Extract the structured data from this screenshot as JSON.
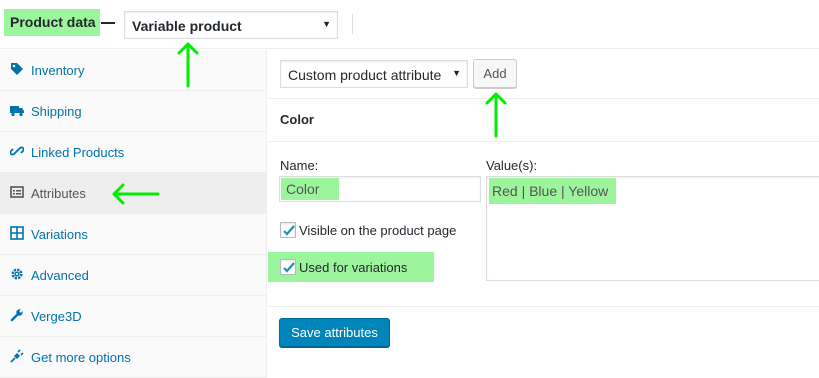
{
  "header": {
    "title": "Product data",
    "product_type": "Variable product"
  },
  "sidebar": {
    "items": [
      {
        "label": "Inventory",
        "icon": "tag-icon"
      },
      {
        "label": "Shipping",
        "icon": "truck-icon"
      },
      {
        "label": "Linked Products",
        "icon": "link-icon"
      },
      {
        "label": "Attributes",
        "icon": "list-icon",
        "active": true
      },
      {
        "label": "Variations",
        "icon": "grid-icon"
      },
      {
        "label": "Advanced",
        "icon": "gear-icon"
      },
      {
        "label": "Verge3D",
        "icon": "wrench-icon"
      },
      {
        "label": "Get more options",
        "icon": "plug-icon"
      }
    ]
  },
  "toolbar": {
    "attribute_select": "Custom product attribute",
    "add_label": "Add"
  },
  "attribute": {
    "heading": "Color",
    "name_label": "Name:",
    "name_value": "Color",
    "values_label": "Value(s):",
    "values_value": "Red | Blue | Yellow",
    "visible_label": "Visible on the product page",
    "visible_checked": true,
    "variations_label": "Used for variations",
    "variations_checked": true
  },
  "actions": {
    "save_label": "Save attributes"
  },
  "colors": {
    "highlight": "#9cf59c",
    "annotation_arrow": "#00ee00",
    "link": "#0073aa",
    "primary_button": "#0085ba"
  }
}
